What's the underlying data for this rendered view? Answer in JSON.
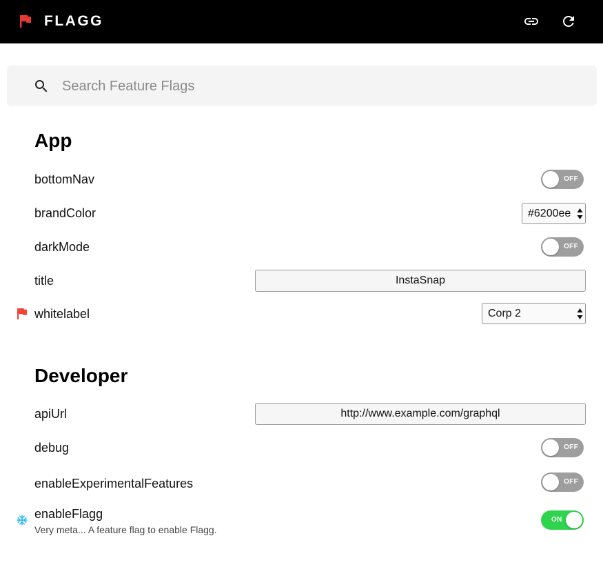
{
  "app": {
    "title": "FLAGG",
    "accent_color": "#e53935",
    "header_background": "#000000",
    "header_actions": [
      {
        "icon": "link-icon"
      },
      {
        "icon": "refresh-icon"
      }
    ]
  },
  "search": {
    "placeholder": "Search Feature Flags",
    "value": ""
  },
  "sections": [
    {
      "title": "App",
      "flags": [
        {
          "name": "bottomNav",
          "control": "toggle",
          "state": "OFF"
        },
        {
          "name": "brandColor",
          "control": "select",
          "value": "#6200ee"
        },
        {
          "name": "darkMode",
          "control": "toggle",
          "state": "OFF"
        },
        {
          "name": "title",
          "control": "text",
          "value": "InstaSnap"
        },
        {
          "name": "whitelabel",
          "control": "select",
          "value": "Corp 2",
          "icon": "flag-icon"
        }
      ]
    },
    {
      "title": "Developer",
      "flags": [
        {
          "name": "apiUrl",
          "control": "text",
          "value": "http://www.example.com/graphql"
        },
        {
          "name": "debug",
          "control": "toggle",
          "state": "OFF"
        },
        {
          "name": "enableExperimentalFeatures",
          "control": "toggle",
          "state": "OFF"
        },
        {
          "name": "enableFlagg",
          "control": "toggle",
          "state": "ON",
          "icon": "snowflake-icon",
          "description": "Very meta... A feature flag to enable Flagg."
        }
      ]
    }
  ],
  "colors": {
    "toggle_off": "#9e9e9e",
    "toggle_on": "#2fd44e",
    "flag_red": "#f44336",
    "snowflake_blue": "#29b6f6"
  }
}
